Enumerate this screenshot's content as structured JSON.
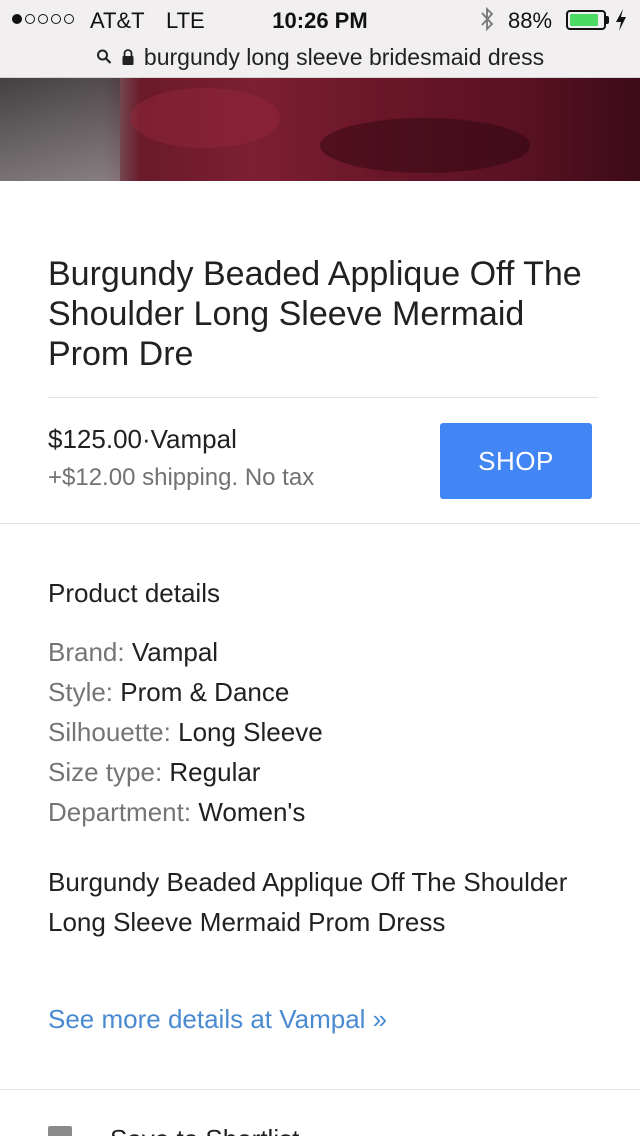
{
  "status_bar": {
    "carrier": "AT&T",
    "network": "LTE",
    "time": "10:26 PM",
    "battery_percent": "88%",
    "battery_level": 0.88,
    "signal_bars": 1,
    "signal_max": 5,
    "icons": [
      "bluetooth-icon",
      "battery-icon",
      "charging-icon"
    ]
  },
  "url_bar": {
    "query": "burgundy long sleeve bridesmaid dress",
    "icons": [
      "search-icon",
      "lock-icon"
    ]
  },
  "product": {
    "title": "Burgundy Beaded Applique Off The Shoulder Long Sleeve Mermaid Prom Dre",
    "price_seller": "$125.00·Vampal",
    "shipping": "+$12.00 shipping. No tax",
    "shop_label": "SHOP",
    "shop_color": "#4285f4"
  },
  "details": {
    "heading": "Product details",
    "specs": [
      {
        "label": "Brand:",
        "value": "Vampal"
      },
      {
        "label": "Style:",
        "value": "Prom & Dance"
      },
      {
        "label": "Silhouette:",
        "value": "Long Sleeve"
      },
      {
        "label": "Size type:",
        "value": "Regular"
      },
      {
        "label": "Department:",
        "value": "Women's"
      }
    ],
    "description": "Burgundy Beaded Applique Off The Shoulder Long Sleeve Mermaid Prom Dress",
    "more_link": "See more details at Vampal »",
    "link_color": "#4a8ad0"
  },
  "bottom": {
    "partial_text": "Save to Shortlist"
  }
}
